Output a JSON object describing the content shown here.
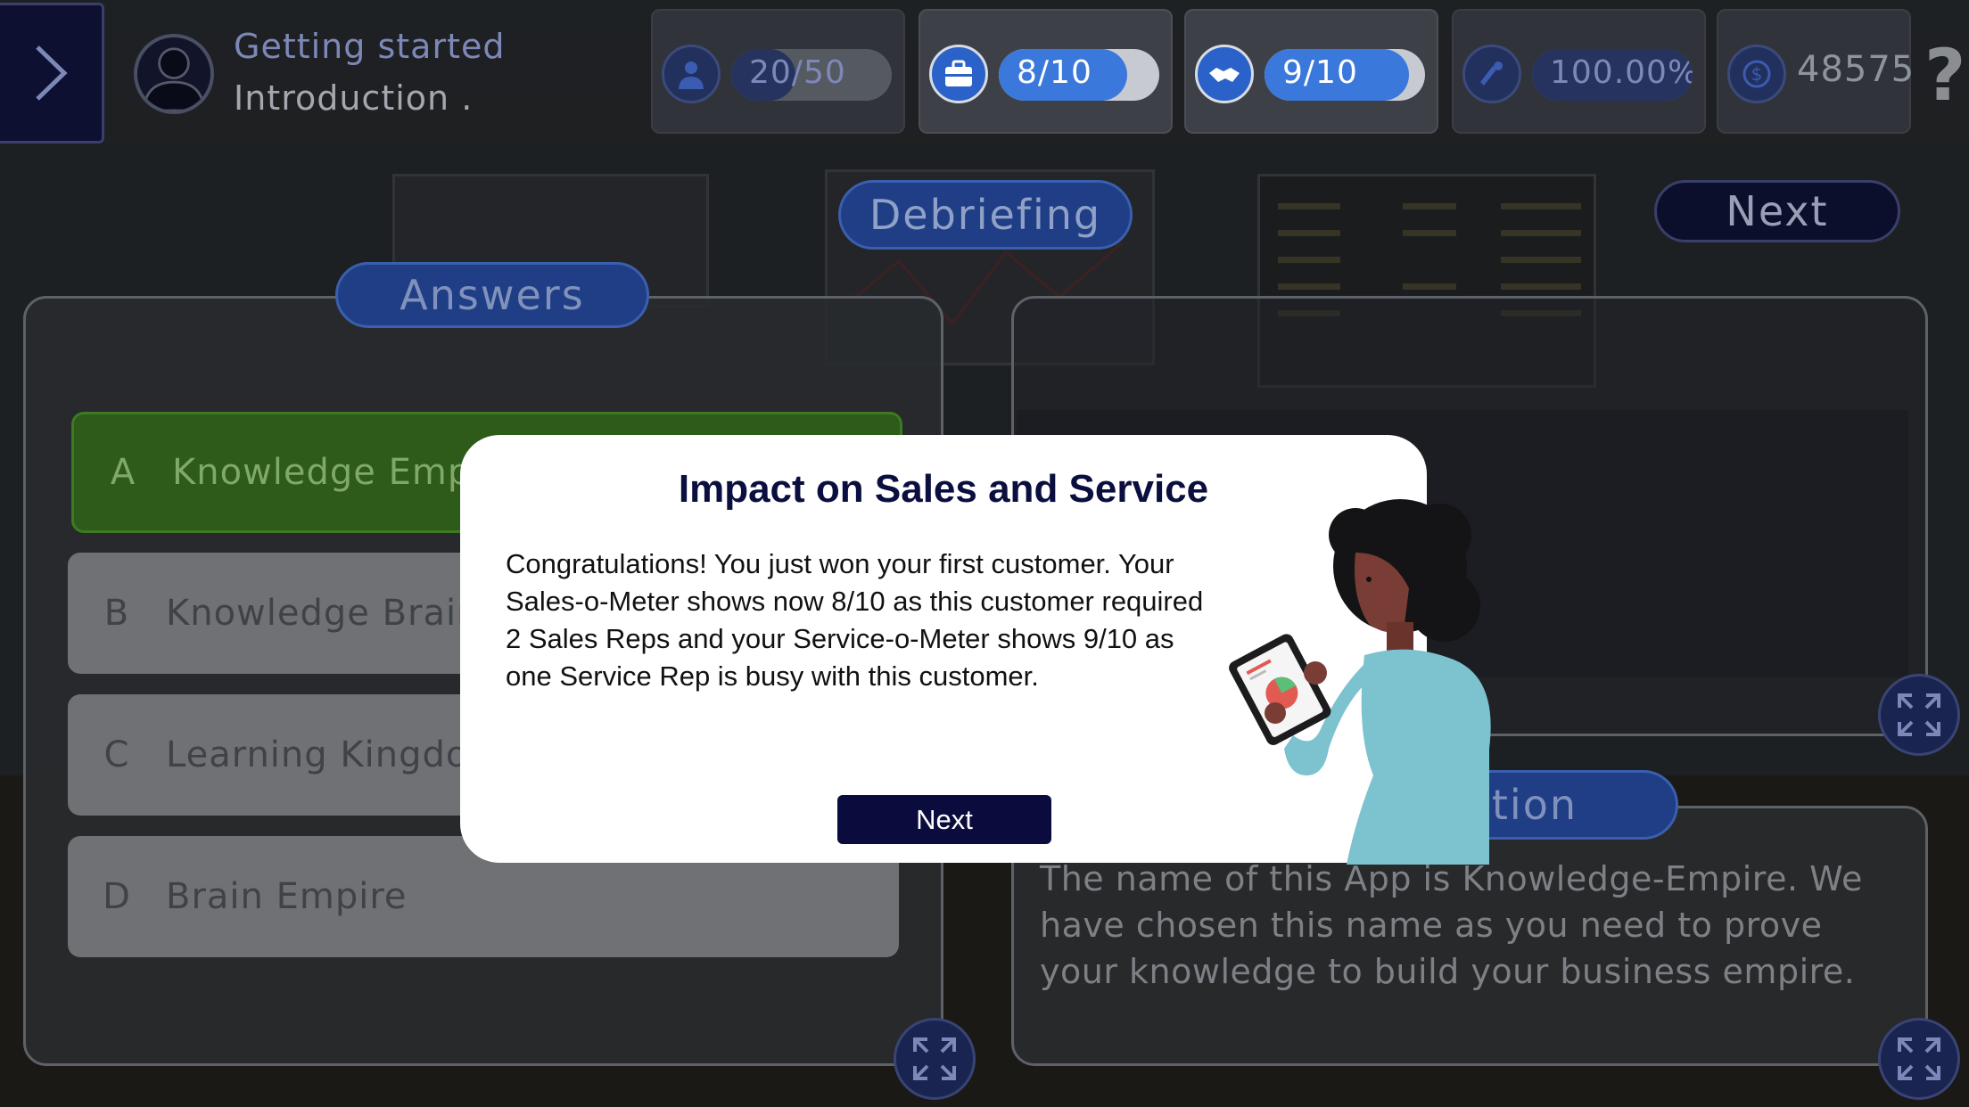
{
  "header": {
    "title": "Getting started",
    "subtitle": "Introduction ."
  },
  "stats": [
    {
      "label": "20/50",
      "icon": "person-icon",
      "progress": 0.4,
      "active": false
    },
    {
      "label": "8/10",
      "icon": "briefcase-icon",
      "progress": 0.8,
      "active": true
    },
    {
      "label": "9/10",
      "icon": "handshake-icon",
      "progress": 0.9,
      "active": true
    },
    {
      "label": "100.00%",
      "icon": "gauge-icon",
      "progress": 1.0,
      "active": false
    }
  ],
  "coins": {
    "value": "48575",
    "icon": "dollar-coin-icon"
  },
  "help_label": "?",
  "buttons": {
    "debriefing": "Debriefing",
    "next": "Next"
  },
  "answers": {
    "tab_label": "Answers",
    "items": [
      {
        "letter": "A",
        "text": "Knowledge Empire",
        "correct": true
      },
      {
        "letter": "B",
        "text": "Knowledge Brain",
        "correct": false
      },
      {
        "letter": "C",
        "text": "Learning Kingdom",
        "correct": false
      },
      {
        "letter": "D",
        "text": "Brain Empire",
        "correct": false
      }
    ]
  },
  "information": {
    "tab_label": "mation",
    "text": "The name of this App is Knowledge-Empire. We have chosen this name as you need to prove your knowledge to build your business empire."
  },
  "modal": {
    "title": "Impact on Sales and Service",
    "body": "Congratulations! You just won your first customer. Your Sales-o-Meter shows now 8/10 as this customer required 2 Sales Reps and your Service-o-Meter shows 9/10 as one Service Rep is busy with this customer.",
    "next_label": "Next"
  },
  "colors": {
    "accent_blue": "#3a78dc",
    "navy": "#0b0c3e",
    "correct_green": "#2e5a1a"
  }
}
